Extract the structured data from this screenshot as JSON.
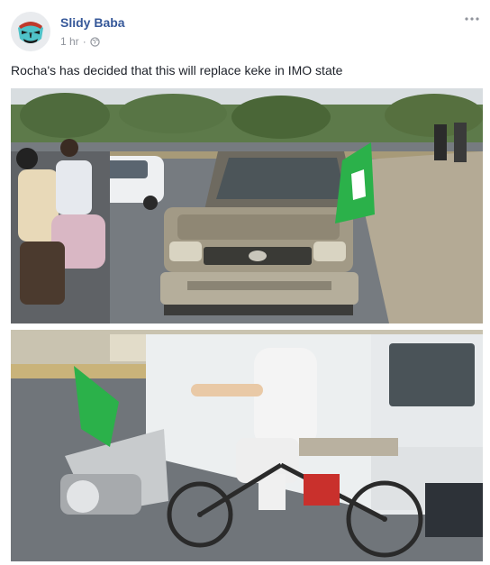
{
  "post": {
    "author_name": "Slidy Baba",
    "timestamp": "1 hr",
    "separator": "·",
    "privacy_icon": "globe-icon",
    "more_icon": "more-horizontal-icon",
    "body_text": "Rocha's has decided that this will replace keke in IMO state"
  },
  "colors": {
    "author_link": "#365899",
    "meta_gray": "#90949c",
    "text": "#1d2129",
    "flag_green": "#2bb14a"
  }
}
